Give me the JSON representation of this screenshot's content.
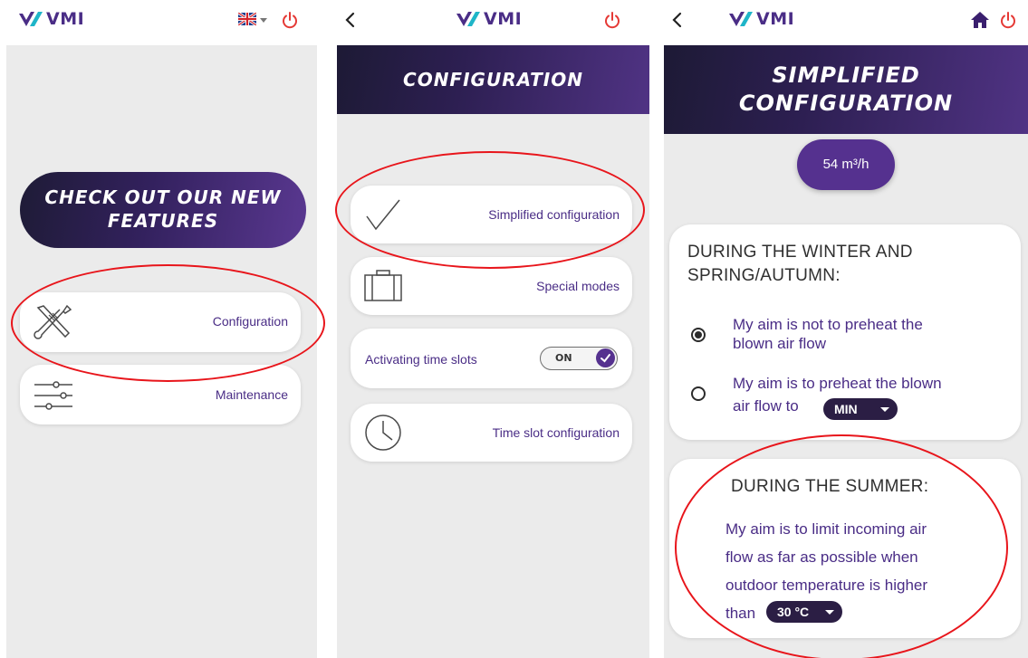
{
  "colors": {
    "accent": "#55318f",
    "power": "#e53935",
    "annotation": "#e8151b"
  },
  "brand": {
    "logo_text": "VMI",
    "logo_icon": "vmi-logo-icon"
  },
  "screen1": {
    "language_icon": "uk-flag-icon",
    "cta_line1": "CHECK OUT OUR NEW",
    "cta_line2": "FEATURES",
    "menu": [
      {
        "label": "Configuration",
        "icon": "tools-icon"
      },
      {
        "label": "Maintenance",
        "icon": "sliders-icon"
      }
    ]
  },
  "screen2": {
    "title": "CONFIGURATION",
    "items": [
      {
        "label": "Simplified configuration",
        "icon": "checkmark-icon"
      },
      {
        "label": "Special modes",
        "icon": "suitcase-icon"
      },
      {
        "label": "Activating time slots",
        "toggle": "ON"
      },
      {
        "label": "Time slot configuration",
        "icon": "clock-icon"
      }
    ]
  },
  "screen3": {
    "title_line1": "SIMPLIFIED",
    "title_line2": "CONFIGURATION",
    "airflow": "54 m³/h",
    "winter": {
      "title_line1": "DURING THE WINTER AND",
      "title_line2": "SPRING/AUTUMN:",
      "option1_line1": "My aim is not to preheat the",
      "option1_line2": "blown air flow",
      "option2_line1": "My aim is to preheat the blown",
      "option2_line2": "air flow to",
      "option2_value": "MIN",
      "selected": 1
    },
    "summer": {
      "title": "DURING THE SUMMER:",
      "line1": "My aim is to limit incoming air",
      "line2": "flow as far as possible when",
      "line3": "outdoor temperature is higher",
      "line4": "than",
      "value": "30 °C"
    }
  }
}
